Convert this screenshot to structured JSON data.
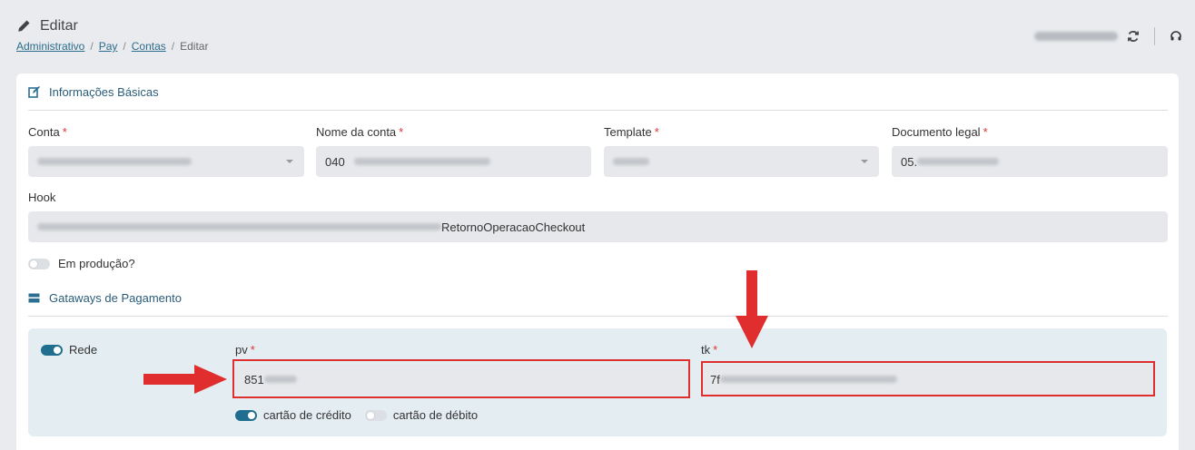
{
  "header": {
    "title": "Editar",
    "breadcrumb": [
      "Administrativo",
      "Pay",
      "Contas",
      "Editar"
    ]
  },
  "basic_info": {
    "section_title": "Informações Básicas",
    "fields": {
      "conta": {
        "label": "Conta",
        "required": "*"
      },
      "nome_da_conta": {
        "label": "Nome da conta",
        "required": "*",
        "value": "040"
      },
      "template": {
        "label": "Template",
        "required": "*"
      },
      "documento_legal": {
        "label": "Documento legal",
        "required": "*",
        "value": "05."
      }
    },
    "hook": {
      "label": "Hook",
      "value_suffix": "RetornoOperacaoCheckout"
    },
    "em_producao": {
      "label": "Em produção?",
      "on": false
    }
  },
  "gateways": {
    "section_title": "Gataways de Pagamento",
    "rede": {
      "label": "Rede",
      "on": true,
      "pv": {
        "label": "pv",
        "required": "*",
        "value": "851"
      },
      "tk": {
        "label": "tk",
        "required": "*",
        "value": "7f"
      },
      "credito": {
        "label": "cartão de crédito",
        "on": true
      },
      "debito": {
        "label": "cartão de débito",
        "on": false
      }
    }
  },
  "colors": {
    "accent": "#206e8f",
    "highlight": "#e02d2d"
  }
}
